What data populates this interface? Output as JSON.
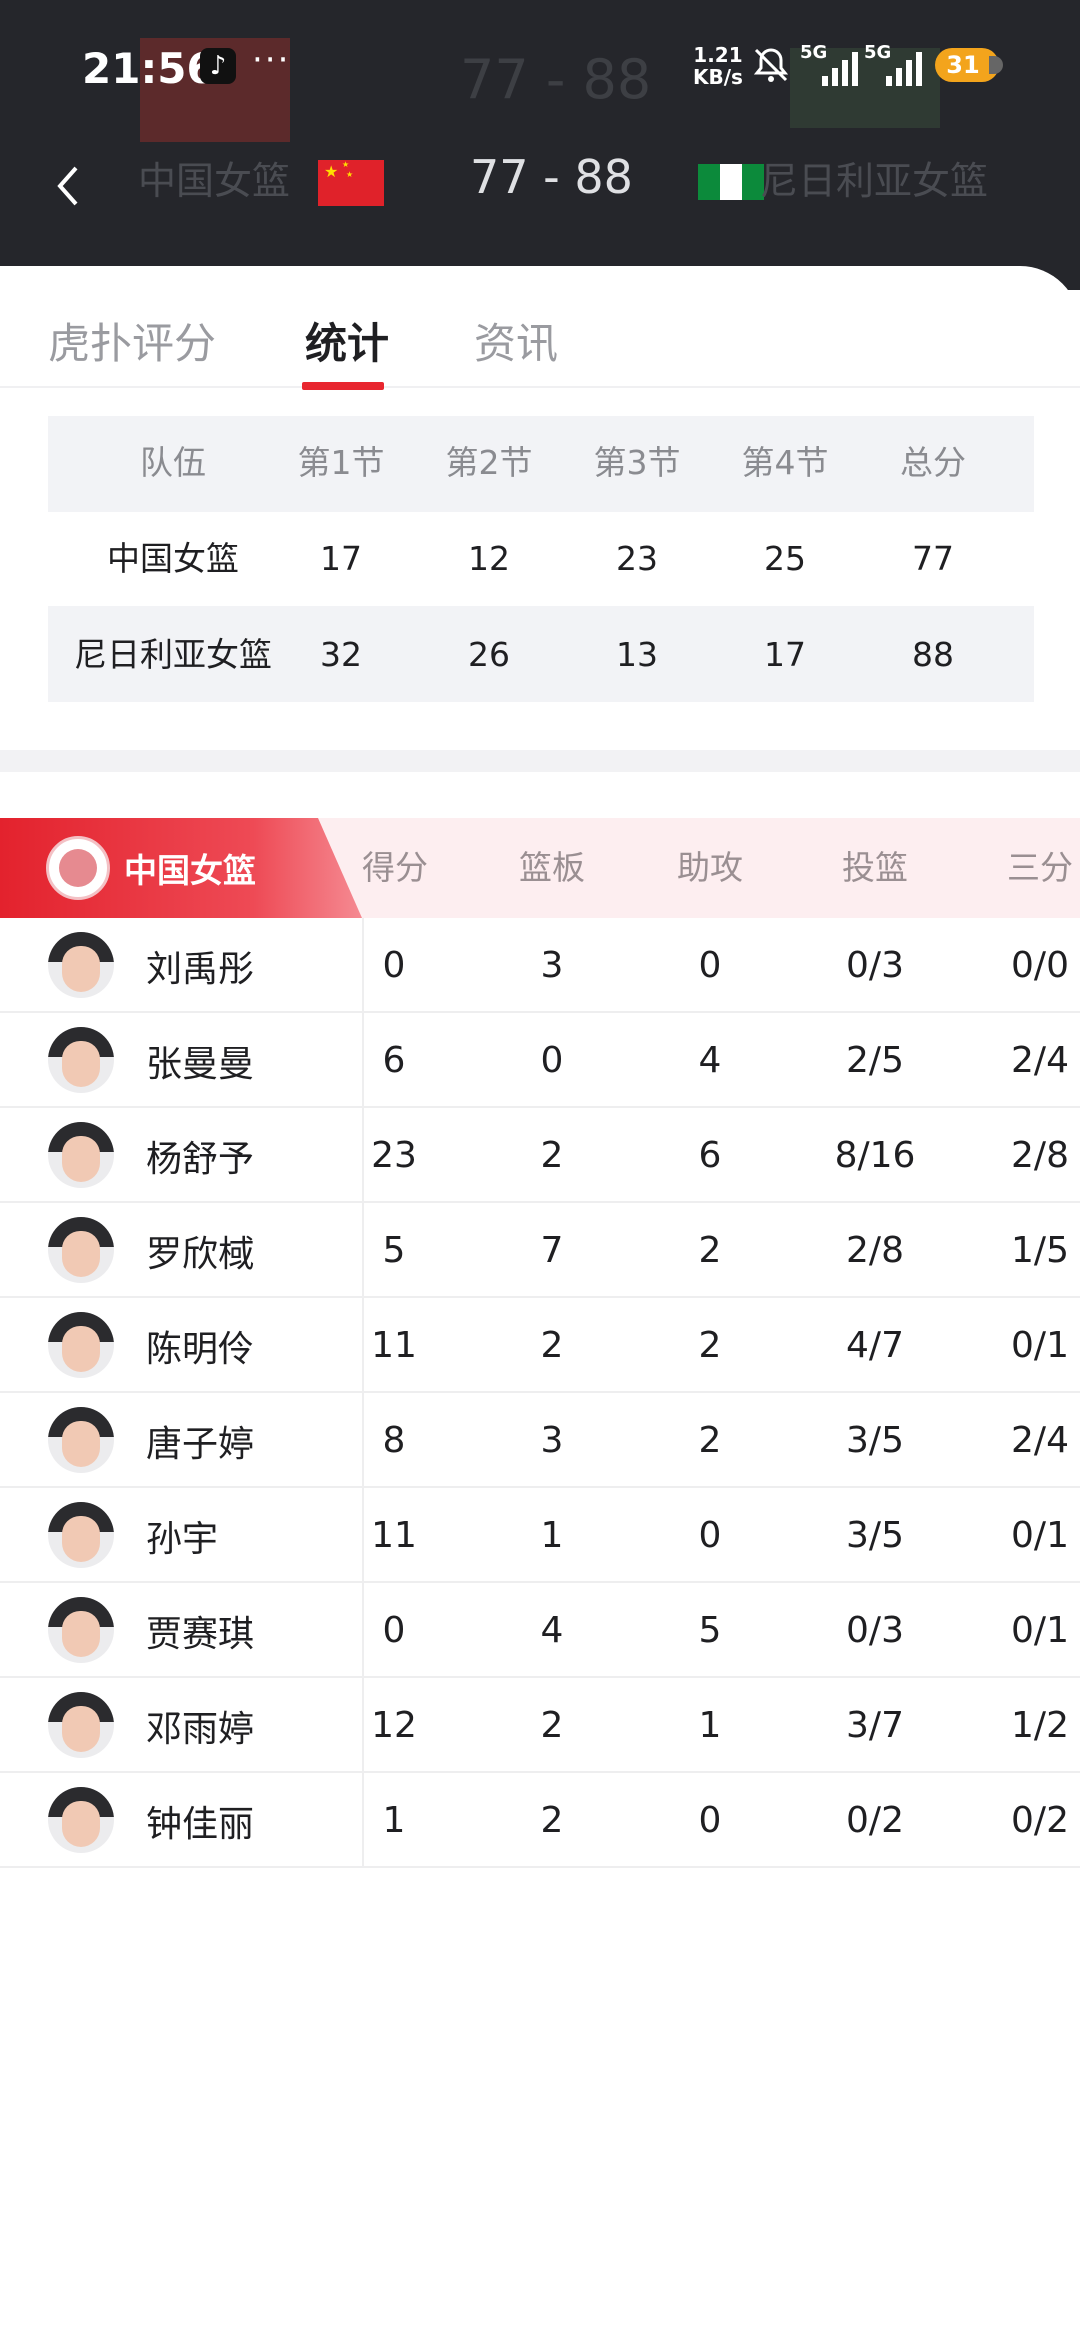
{
  "status_bar": {
    "time": "21:56",
    "net_speed_value": "1.21",
    "net_speed_unit": "KB/s",
    "signal1_label": "5G",
    "signal2_label": "5G",
    "battery": "31"
  },
  "header": {
    "ghost_score": "77 - 88",
    "home_team": "中国女篮",
    "score": "77 - 88",
    "away_team": "尼日利亚女篮"
  },
  "tabs": [
    "虎扑评分",
    "统计",
    "资讯"
  ],
  "active_tab": "统计",
  "quarter_table": {
    "headers": [
      "队伍",
      "第1节",
      "第2节",
      "第3节",
      "第4节",
      "总分"
    ],
    "rows": [
      [
        "中国女篮",
        "17",
        "12",
        "23",
        "25",
        "77"
      ],
      [
        "尼日利亚女篮",
        "32",
        "26",
        "13",
        "17",
        "88"
      ]
    ]
  },
  "player_stats": {
    "team": "中国女篮",
    "headers": [
      "得分",
      "篮板",
      "助攻",
      "投篮",
      "三分"
    ],
    "players": [
      {
        "name": "刘禹彤",
        "values": [
          "0",
          "3",
          "0",
          "0/3",
          "0/0"
        ]
      },
      {
        "name": "张曼曼",
        "values": [
          "6",
          "0",
          "4",
          "2/5",
          "2/4"
        ]
      },
      {
        "name": "杨舒予",
        "values": [
          "23",
          "2",
          "6",
          "8/16",
          "2/8"
        ]
      },
      {
        "name": "罗欣棫",
        "values": [
          "5",
          "7",
          "2",
          "2/8",
          "1/5"
        ]
      },
      {
        "name": "陈明伶",
        "values": [
          "11",
          "2",
          "2",
          "4/7",
          "0/1"
        ]
      },
      {
        "name": "唐子婷",
        "values": [
          "8",
          "3",
          "2",
          "3/5",
          "2/4"
        ]
      },
      {
        "name": "孙宇",
        "values": [
          "11",
          "1",
          "0",
          "3/5",
          "0/1"
        ]
      },
      {
        "name": "贾赛琪",
        "values": [
          "0",
          "4",
          "5",
          "0/3",
          "0/1"
        ]
      },
      {
        "name": "邓雨婷",
        "values": [
          "12",
          "2",
          "1",
          "3/7",
          "1/2"
        ]
      },
      {
        "name": "钟佳丽",
        "values": [
          "1",
          "2",
          "0",
          "0/2",
          "0/2"
        ]
      }
    ]
  },
  "colors": {
    "header_bg": "#25262b",
    "accent_red": "#e8262f",
    "stats_header_bg": "#fdeef0",
    "battery": "#f3a41c"
  },
  "icons": [
    "tiktok-icon",
    "more-dots-icon",
    "mute-icon",
    "signal-icon",
    "battery-icon",
    "back-icon",
    "china-flag-icon",
    "nigeria-flag-icon",
    "basketball-icon",
    "avatar"
  ]
}
